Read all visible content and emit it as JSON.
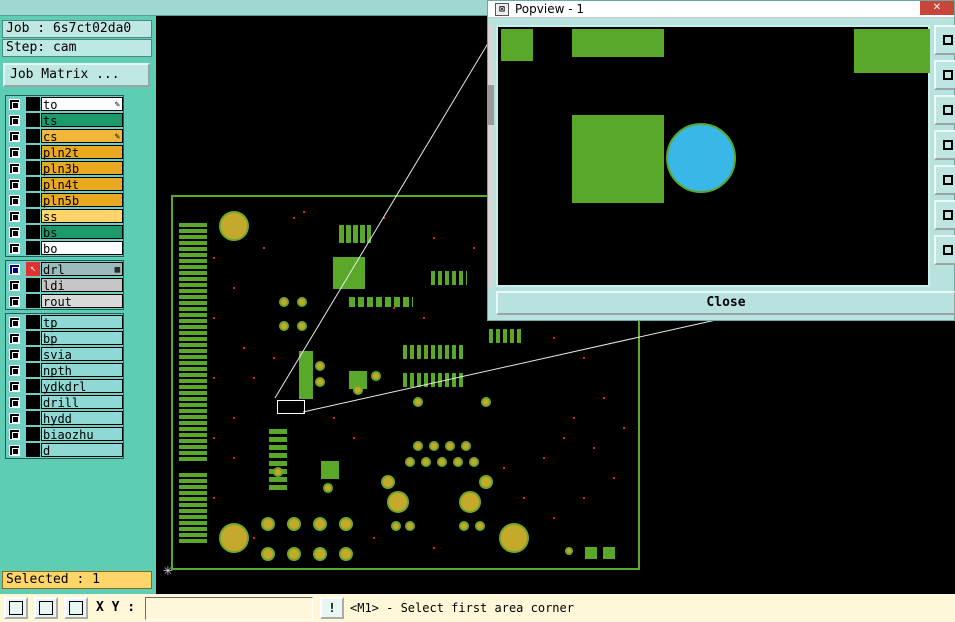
{
  "left_panel": {
    "job_label": "Job : 6s7ct02da0",
    "step_label": "Step: cam",
    "job_matrix_button": "Job Matrix ...",
    "signal_layers": [
      {
        "name": "to",
        "color": "#ffffff",
        "checked": false,
        "mark": "edit-icon"
      },
      {
        "name": "ts",
        "color": "#1d9a6c",
        "checked": false,
        "mark": ""
      },
      {
        "name": "cs",
        "color": "#f0b73a",
        "checked": false,
        "mark": "edit-icon"
      },
      {
        "name": "pln2t",
        "color": "#e8a921",
        "checked": false,
        "mark": ""
      },
      {
        "name": "pln3b",
        "color": "#e8a921",
        "checked": false,
        "mark": ""
      },
      {
        "name": "pln4t",
        "color": "#e8a921",
        "checked": false,
        "mark": ""
      },
      {
        "name": "pln5b",
        "color": "#e8a921",
        "checked": false,
        "mark": ""
      },
      {
        "name": "ss",
        "color": "#ffd56a",
        "checked": false,
        "mark": ""
      },
      {
        "name": "bs",
        "color": "#1d9a6c",
        "checked": false,
        "mark": ""
      },
      {
        "name": "bo",
        "color": "#ffffff",
        "checked": false,
        "mark": ""
      }
    ],
    "drill_layers": [
      {
        "name": "drl",
        "color": "#9bbcbc",
        "checked": true,
        "mark": "menu-icon"
      },
      {
        "name": "ldi",
        "color": "#c6c6c6",
        "checked": false,
        "mark": ""
      },
      {
        "name": "rout",
        "color": "#d9d9d9",
        "checked": false,
        "mark": ""
      }
    ],
    "doc_layers": [
      {
        "name": "tp",
        "color": "#8fd8d3",
        "checked": false,
        "mark": ""
      },
      {
        "name": "bp",
        "color": "#8fd8d3",
        "checked": false,
        "mark": ""
      },
      {
        "name": "svia",
        "color": "#8fd8d3",
        "checked": false,
        "mark": ""
      },
      {
        "name": "npth",
        "color": "#8fd8d3",
        "checked": false,
        "mark": ""
      },
      {
        "name": "ydkdrl",
        "color": "#8fd8d3",
        "checked": false,
        "mark": ""
      },
      {
        "name": "drill",
        "color": "#8fd8d3",
        "checked": false,
        "mark": ""
      },
      {
        "name": "hydd",
        "color": "#8fd8d3",
        "checked": false,
        "mark": ""
      },
      {
        "name": "biaozhu",
        "color": "#8fd8d3",
        "checked": false,
        "mark": ""
      },
      {
        "name": "d",
        "color": "#8fd8d3",
        "checked": false,
        "mark": ""
      }
    ],
    "selected_label": "Selected : 1"
  },
  "popview": {
    "title": "Popview - 1",
    "close_glyph": "✕",
    "close_button": "Close",
    "tools": [
      "zoom-in-icon",
      "zoom-out-icon",
      "fit-icon",
      "pan-left-icon",
      "pan-right-icon",
      "pan-horizontal-icon",
      "pan-vertical-icon"
    ]
  },
  "bottom_bar": {
    "xy_label": "X Y :",
    "xy_value": "",
    "warn_glyph": "!",
    "status": "<M1> - Select first area corner"
  },
  "colors": {
    "copper": "#5aa829",
    "pad_gold": "#c4a92a",
    "drill_dot": "#e0222a",
    "popview_circle": "#38b7e8",
    "panel_bg": "#5fcdb4"
  }
}
